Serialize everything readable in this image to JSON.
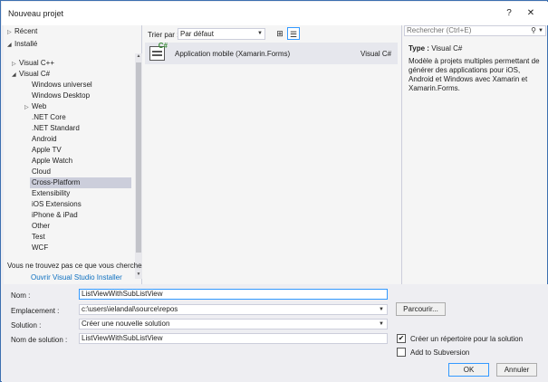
{
  "window": {
    "title": "Nouveau projet",
    "help": "?",
    "close": "✕"
  },
  "tree": {
    "recent": "Récent",
    "installed": "Installé",
    "visual_cpp": "Visual C++",
    "visual_csharp": "Visual C#",
    "items": [
      "Windows universel",
      "Windows Desktop",
      "Web",
      ".NET Core",
      ".NET Standard",
      "Android",
      "Apple TV",
      "Apple Watch",
      "Cloud",
      "Cross-Platform",
      "Extensibility",
      "iOS Extensions",
      "iPhone & iPad",
      "Other",
      "Test",
      "WCF"
    ],
    "selected": "Cross-Platform"
  },
  "not_found": {
    "text": "Vous ne trouvez pas ce que vous cherchez ?",
    "link": "Ouvrir Visual Studio Installer"
  },
  "sort": {
    "label": "Trier par :",
    "value": "Par défaut"
  },
  "templates": [
    {
      "name": "Application mobile (Xamarin.Forms)",
      "lang": "Visual C#"
    }
  ],
  "search": {
    "placeholder": "Rechercher (Ctrl+E)"
  },
  "details": {
    "type_label": "Type :",
    "type_value": "Visual C#",
    "description": "Modèle à projets multiples permettant de générer des applications pour iOS, Android et Windows avec Xamarin et Xamarin.Forms."
  },
  "form": {
    "name_label": "Nom :",
    "name_value": "ListViewWithSubListView",
    "location_label": "Emplacement :",
    "location_value": "c:\\users\\ielandal\\source\\repos",
    "browse_label": "Parcourir...",
    "solution_label": "Solution :",
    "solution_value": "Créer une nouvelle solution",
    "solution_name_label": "Nom de solution :",
    "solution_name_value": "ListViewWithSubListView",
    "create_dir_label": "Créer un répertoire pour la solution",
    "create_dir_checked": true,
    "subversion_label": "Add to Subversion",
    "subversion_checked": false,
    "ok_label": "OK",
    "cancel_label": "Annuler"
  }
}
